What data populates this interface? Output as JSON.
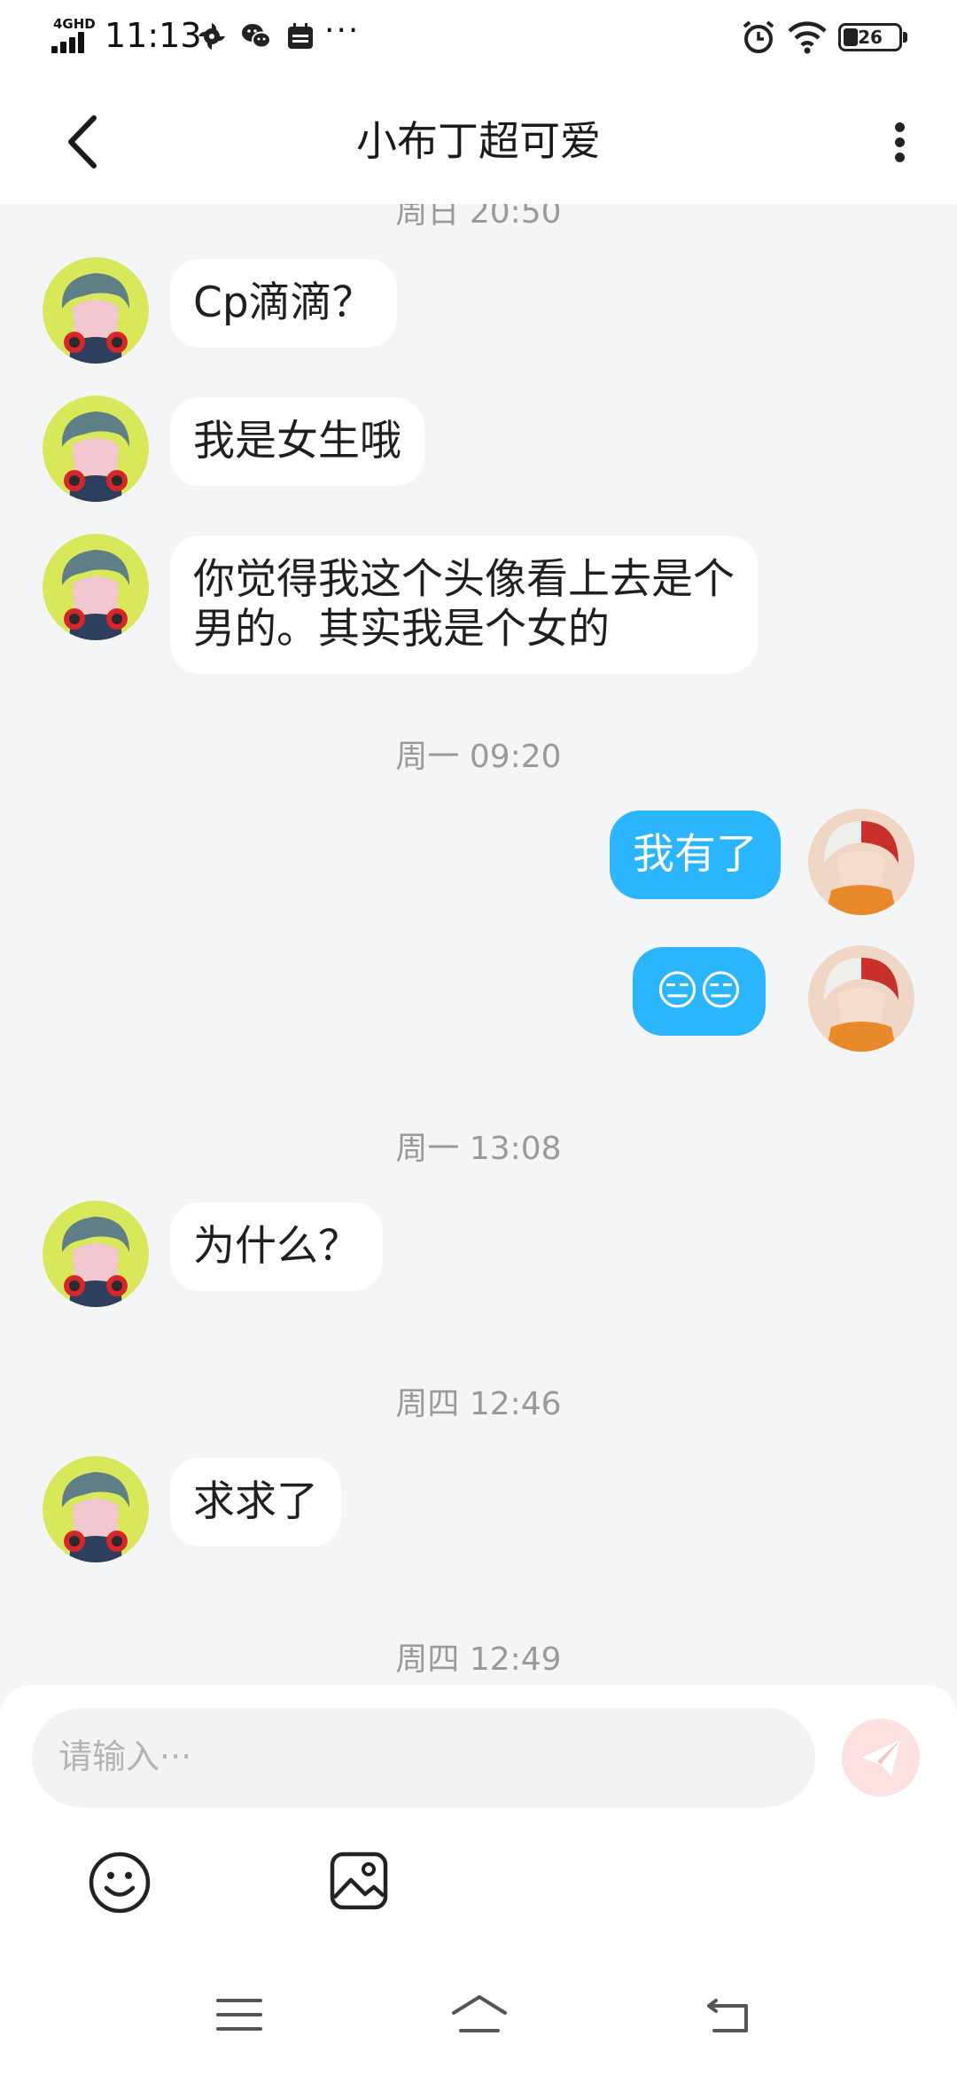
{
  "status_bar": {
    "network": "4GHD",
    "time": "11:13",
    "battery": "26",
    "overflow": "···"
  },
  "header": {
    "title": "小布丁超可爱"
  },
  "messages": [
    {
      "kind": "timestamp",
      "text": "周日 20:50"
    },
    {
      "kind": "in",
      "text": "Cp滴滴？"
    },
    {
      "kind": "in",
      "text": "我是女生哦"
    },
    {
      "kind": "in",
      "text": "你觉得我这个头像看上去是个\n男的。其实我是个女的"
    },
    {
      "kind": "timestamp",
      "text": "周一 09:20"
    },
    {
      "kind": "out",
      "text": "我有了"
    },
    {
      "kind": "out",
      "text": "😑😑"
    },
    {
      "kind": "timestamp",
      "text": "周一 13:08"
    },
    {
      "kind": "in",
      "text": "为什么？"
    },
    {
      "kind": "timestamp",
      "text": "周四 12:46"
    },
    {
      "kind": "in",
      "text": "求求了"
    },
    {
      "kind": "timestamp",
      "text": "周四 12:49"
    }
  ],
  "composer": {
    "placeholder": "请输入···"
  },
  "colors": {
    "outgoing_bubble": "#2bb5ff",
    "send_button": "#fde0e0",
    "background": "#f4f5f7"
  }
}
